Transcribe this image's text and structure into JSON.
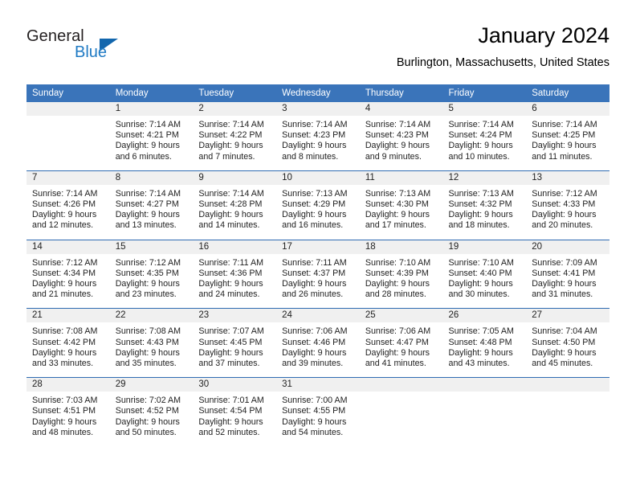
{
  "logo": {
    "word_one": "General",
    "word_two": "Blue",
    "triangle": "blue-triangle"
  },
  "header": {
    "title": "January 2024",
    "location": "Burlington, Massachusetts, United States"
  },
  "colors": {
    "header_blue": "#3a74ba",
    "row_divider_blue": "#2f6bb2",
    "daynum_band": "#f0f0f0",
    "logo_blue": "#1f7ac4",
    "text": "#222222"
  },
  "weekday_headers": [
    "Sunday",
    "Monday",
    "Tuesday",
    "Wednesday",
    "Thursday",
    "Friday",
    "Saturday"
  ],
  "weeks": [
    [
      {
        "day": "",
        "lines": []
      },
      {
        "day": "1",
        "lines": [
          "Sunrise: 7:14 AM",
          "Sunset: 4:21 PM",
          "Daylight: 9 hours",
          "and 6 minutes."
        ]
      },
      {
        "day": "2",
        "lines": [
          "Sunrise: 7:14 AM",
          "Sunset: 4:22 PM",
          "Daylight: 9 hours",
          "and 7 minutes."
        ]
      },
      {
        "day": "3",
        "lines": [
          "Sunrise: 7:14 AM",
          "Sunset: 4:23 PM",
          "Daylight: 9 hours",
          "and 8 minutes."
        ]
      },
      {
        "day": "4",
        "lines": [
          "Sunrise: 7:14 AM",
          "Sunset: 4:23 PM",
          "Daylight: 9 hours",
          "and 9 minutes."
        ]
      },
      {
        "day": "5",
        "lines": [
          "Sunrise: 7:14 AM",
          "Sunset: 4:24 PM",
          "Daylight: 9 hours",
          "and 10 minutes."
        ]
      },
      {
        "day": "6",
        "lines": [
          "Sunrise: 7:14 AM",
          "Sunset: 4:25 PM",
          "Daylight: 9 hours",
          "and 11 minutes."
        ]
      }
    ],
    [
      {
        "day": "7",
        "lines": [
          "Sunrise: 7:14 AM",
          "Sunset: 4:26 PM",
          "Daylight: 9 hours",
          "and 12 minutes."
        ]
      },
      {
        "day": "8",
        "lines": [
          "Sunrise: 7:14 AM",
          "Sunset: 4:27 PM",
          "Daylight: 9 hours",
          "and 13 minutes."
        ]
      },
      {
        "day": "9",
        "lines": [
          "Sunrise: 7:14 AM",
          "Sunset: 4:28 PM",
          "Daylight: 9 hours",
          "and 14 minutes."
        ]
      },
      {
        "day": "10",
        "lines": [
          "Sunrise: 7:13 AM",
          "Sunset: 4:29 PM",
          "Daylight: 9 hours",
          "and 16 minutes."
        ]
      },
      {
        "day": "11",
        "lines": [
          "Sunrise: 7:13 AM",
          "Sunset: 4:30 PM",
          "Daylight: 9 hours",
          "and 17 minutes."
        ]
      },
      {
        "day": "12",
        "lines": [
          "Sunrise: 7:13 AM",
          "Sunset: 4:32 PM",
          "Daylight: 9 hours",
          "and 18 minutes."
        ]
      },
      {
        "day": "13",
        "lines": [
          "Sunrise: 7:12 AM",
          "Sunset: 4:33 PM",
          "Daylight: 9 hours",
          "and 20 minutes."
        ]
      }
    ],
    [
      {
        "day": "14",
        "lines": [
          "Sunrise: 7:12 AM",
          "Sunset: 4:34 PM",
          "Daylight: 9 hours",
          "and 21 minutes."
        ]
      },
      {
        "day": "15",
        "lines": [
          "Sunrise: 7:12 AM",
          "Sunset: 4:35 PM",
          "Daylight: 9 hours",
          "and 23 minutes."
        ]
      },
      {
        "day": "16",
        "lines": [
          "Sunrise: 7:11 AM",
          "Sunset: 4:36 PM",
          "Daylight: 9 hours",
          "and 24 minutes."
        ]
      },
      {
        "day": "17",
        "lines": [
          "Sunrise: 7:11 AM",
          "Sunset: 4:37 PM",
          "Daylight: 9 hours",
          "and 26 minutes."
        ]
      },
      {
        "day": "18",
        "lines": [
          "Sunrise: 7:10 AM",
          "Sunset: 4:39 PM",
          "Daylight: 9 hours",
          "and 28 minutes."
        ]
      },
      {
        "day": "19",
        "lines": [
          "Sunrise: 7:10 AM",
          "Sunset: 4:40 PM",
          "Daylight: 9 hours",
          "and 30 minutes."
        ]
      },
      {
        "day": "20",
        "lines": [
          "Sunrise: 7:09 AM",
          "Sunset: 4:41 PM",
          "Daylight: 9 hours",
          "and 31 minutes."
        ]
      }
    ],
    [
      {
        "day": "21",
        "lines": [
          "Sunrise: 7:08 AM",
          "Sunset: 4:42 PM",
          "Daylight: 9 hours",
          "and 33 minutes."
        ]
      },
      {
        "day": "22",
        "lines": [
          "Sunrise: 7:08 AM",
          "Sunset: 4:43 PM",
          "Daylight: 9 hours",
          "and 35 minutes."
        ]
      },
      {
        "day": "23",
        "lines": [
          "Sunrise: 7:07 AM",
          "Sunset: 4:45 PM",
          "Daylight: 9 hours",
          "and 37 minutes."
        ]
      },
      {
        "day": "24",
        "lines": [
          "Sunrise: 7:06 AM",
          "Sunset: 4:46 PM",
          "Daylight: 9 hours",
          "and 39 minutes."
        ]
      },
      {
        "day": "25",
        "lines": [
          "Sunrise: 7:06 AM",
          "Sunset: 4:47 PM",
          "Daylight: 9 hours",
          "and 41 minutes."
        ]
      },
      {
        "day": "26",
        "lines": [
          "Sunrise: 7:05 AM",
          "Sunset: 4:48 PM",
          "Daylight: 9 hours",
          "and 43 minutes."
        ]
      },
      {
        "day": "27",
        "lines": [
          "Sunrise: 7:04 AM",
          "Sunset: 4:50 PM",
          "Daylight: 9 hours",
          "and 45 minutes."
        ]
      }
    ],
    [
      {
        "day": "28",
        "lines": [
          "Sunrise: 7:03 AM",
          "Sunset: 4:51 PM",
          "Daylight: 9 hours",
          "and 48 minutes."
        ]
      },
      {
        "day": "29",
        "lines": [
          "Sunrise: 7:02 AM",
          "Sunset: 4:52 PM",
          "Daylight: 9 hours",
          "and 50 minutes."
        ]
      },
      {
        "day": "30",
        "lines": [
          "Sunrise: 7:01 AM",
          "Sunset: 4:54 PM",
          "Daylight: 9 hours",
          "and 52 minutes."
        ]
      },
      {
        "day": "31",
        "lines": [
          "Sunrise: 7:00 AM",
          "Sunset: 4:55 PM",
          "Daylight: 9 hours",
          "and 54 minutes."
        ]
      },
      {
        "day": "",
        "lines": []
      },
      {
        "day": "",
        "lines": []
      },
      {
        "day": "",
        "lines": []
      }
    ]
  ]
}
